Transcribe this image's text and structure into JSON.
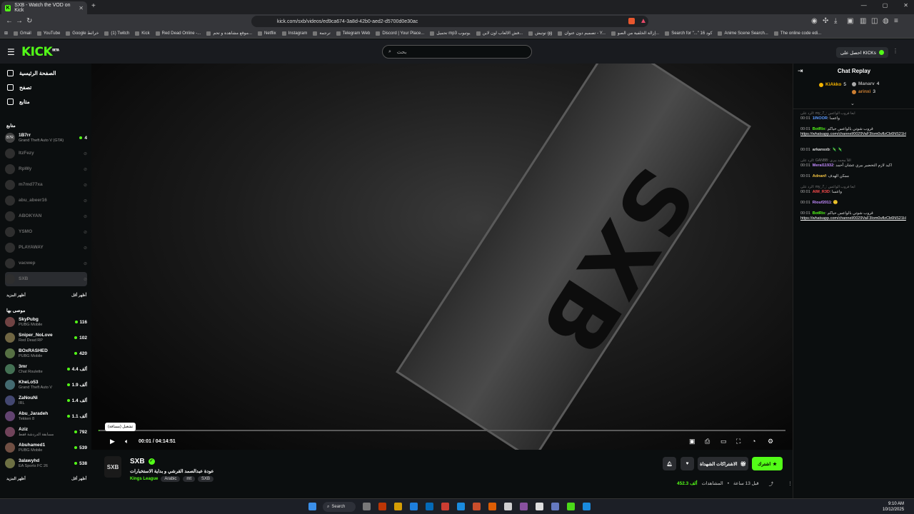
{
  "browser": {
    "tab_title": "SXB - Watch the VOD on Kick",
    "tab_favicon": "K",
    "url": "kick.com/sxb/videos/ed9ca674-3a8d-42b0-aed2-d5700d0e30ac",
    "bookmarks": [
      "Gmail",
      "YouTube",
      "Google خرائط",
      "(1) Twitch",
      "Kick",
      "Red Dead Online -...",
      "موقع مشاهدة و تحم...",
      "Netflix",
      "Instagram",
      "ترجمة",
      "Telegram Web",
      "Discord | Your Place...",
      "تحميل mp3 يوتيوب",
      "فش الالعاب اون لاين...",
      "توتيش gg",
      "تصميم دون عنوان - Y...",
      "إزالة الخلفية من الصو...",
      "Search for \"...\" كود 16",
      "Anime Scene Search...",
      "The online code edi..."
    ]
  },
  "header": {
    "logo": "KICK",
    "logo_badge": "BETA",
    "search_placeholder": "بحث",
    "get_kicks": "احصل على KICKs"
  },
  "sidebar": {
    "nav": [
      {
        "label": "الصفحة الرئيسية",
        "icon": "home-icon"
      },
      {
        "label": "تصفح",
        "icon": "compass-icon"
      },
      {
        "label": "متابع",
        "icon": "heart-icon"
      }
    ],
    "following_title": "متابع",
    "following": [
      {
        "name": "1B7rr",
        "category": "Grand Theft Auto V (GTA)",
        "viewers": "4",
        "live": true,
        "avatar": "B7R"
      },
      {
        "name": "ItzFezy",
        "live": false
      },
      {
        "name": "RpWy",
        "live": false
      },
      {
        "name": "m7md77xa",
        "live": false
      },
      {
        "name": "abu_abeer16",
        "live": false
      },
      {
        "name": "ABOKYAN",
        "live": false
      },
      {
        "name": "YSMO",
        "live": false
      },
      {
        "name": "PLAYAWAY",
        "live": false
      },
      {
        "name": "vacwep",
        "live": false
      },
      {
        "name": "SXB",
        "live": false,
        "selected": true
      }
    ],
    "show_more": "أظهر المزيد",
    "show_less": "أظهر أقل",
    "recommended_title": "موصى بها",
    "recommended": [
      {
        "name": "SkyPubg",
        "category": "PUBG Mobile",
        "viewers": "116"
      },
      {
        "name": "Sniper_NoLove",
        "category": "Red Dead RP",
        "viewers": "102"
      },
      {
        "name": "BOxRASHED",
        "category": "PUBG Mobile",
        "viewers": "420"
      },
      {
        "name": "3mr",
        "category": "Chat Roulette",
        "viewers": "4.4 ألف"
      },
      {
        "name": "KheLo53",
        "category": "Grand Theft Auto V",
        "viewers": "1.9 ألف"
      },
      {
        "name": "ZaNouNi",
        "category": "IRL",
        "viewers": "1.4 ألف"
      },
      {
        "name": "Abu_Jaradeh",
        "category": "Tekken 8",
        "viewers": "1.1 ألف"
      },
      {
        "name": "Aziz",
        "category": "مسابقة الدردشة فقط",
        "viewers": "792"
      },
      {
        "name": "Abuhamed1",
        "category": "PUBG Mobile",
        "viewers": "539"
      },
      {
        "name": "3alawyhd",
        "category": "EA Sports FC 26",
        "viewers": "538"
      }
    ]
  },
  "player": {
    "watermark": "SXB",
    "tooltip": "تشغيل (مسافة)",
    "current_time": "00:01",
    "duration": "04:14:51",
    "progress": 0.001
  },
  "channel": {
    "name": "SXB",
    "avatar_text": "SXB",
    "title": "عودة عبدالصمد القرشي و بداية الاستخبارات",
    "category": "Kings League",
    "tags": [
      "Arabic",
      "mt",
      "SXB"
    ],
    "subscriptions_label": "الاشتراكات الشهداة",
    "follow_label": "اشترك",
    "views_value": "452.3 ألف",
    "views_label": "المشاهدات",
    "time_ago": "قبل 13 ساعة"
  },
  "chat": {
    "title": "Chat Replay",
    "leaders": [
      {
        "name": "KiAkko",
        "count": "5"
      },
      {
        "name": "Manarv",
        "count": "4"
      },
      {
        "name": "arinxi",
        "count": "3"
      }
    ],
    "messages": [
      {
        "reply": "الرد على: my_7_: ابعا فروب الواعس",
        "time": "00:01",
        "user": "1INOOR",
        "color": "#5b9bff",
        "text": "واعسا"
      },
      {
        "time": "00:01",
        "user": "BotRix",
        "color": "#53fc18",
        "text": "قروب شوتي بالواعس حياكم",
        "link": "https://whatsapp.com/channel/0029VaF3Iom0uflzCb6NS21H"
      },
      {
        "time": "00:01",
        "user": "arkansxb",
        "color": "#ddd",
        "text": "🦎 🦎"
      },
      {
        "reply": "الرد على: GANBB: اللأ محمد بيري",
        "time": "00:01",
        "user": "Meral11932",
        "color": "#c38bff",
        "text": "اكيد لازم التحضير بيري عشان أحمد"
      },
      {
        "time": "00:01",
        "user": "Adnanf",
        "color": "#f5c542",
        "text": "ممكن الهدف"
      },
      {
        "reply": "الرد على: my_7_: ابعا فروب الواعس",
        "time": "00:01",
        "user": "AlM_R3D",
        "color": "#ff4d4d",
        "text": "واعسا"
      },
      {
        "time": "00:01",
        "user": "Riouf2011",
        "color": "#c38bff",
        "text": "🙂"
      },
      {
        "time": "00:01",
        "user": "BotRix",
        "color": "#53fc18",
        "text": "قروب شوتي بالواعس حياكم",
        "link": "https://whatsapp.com/channel/0029VaF3Iom0uflzCb6NS21H"
      }
    ]
  },
  "taskbar": {
    "search": "Search",
    "time": "9:10 AM",
    "date": "10/12/2025"
  },
  "colors": {
    "accent": "#53fc18",
    "bg": "#0b0e0f"
  }
}
